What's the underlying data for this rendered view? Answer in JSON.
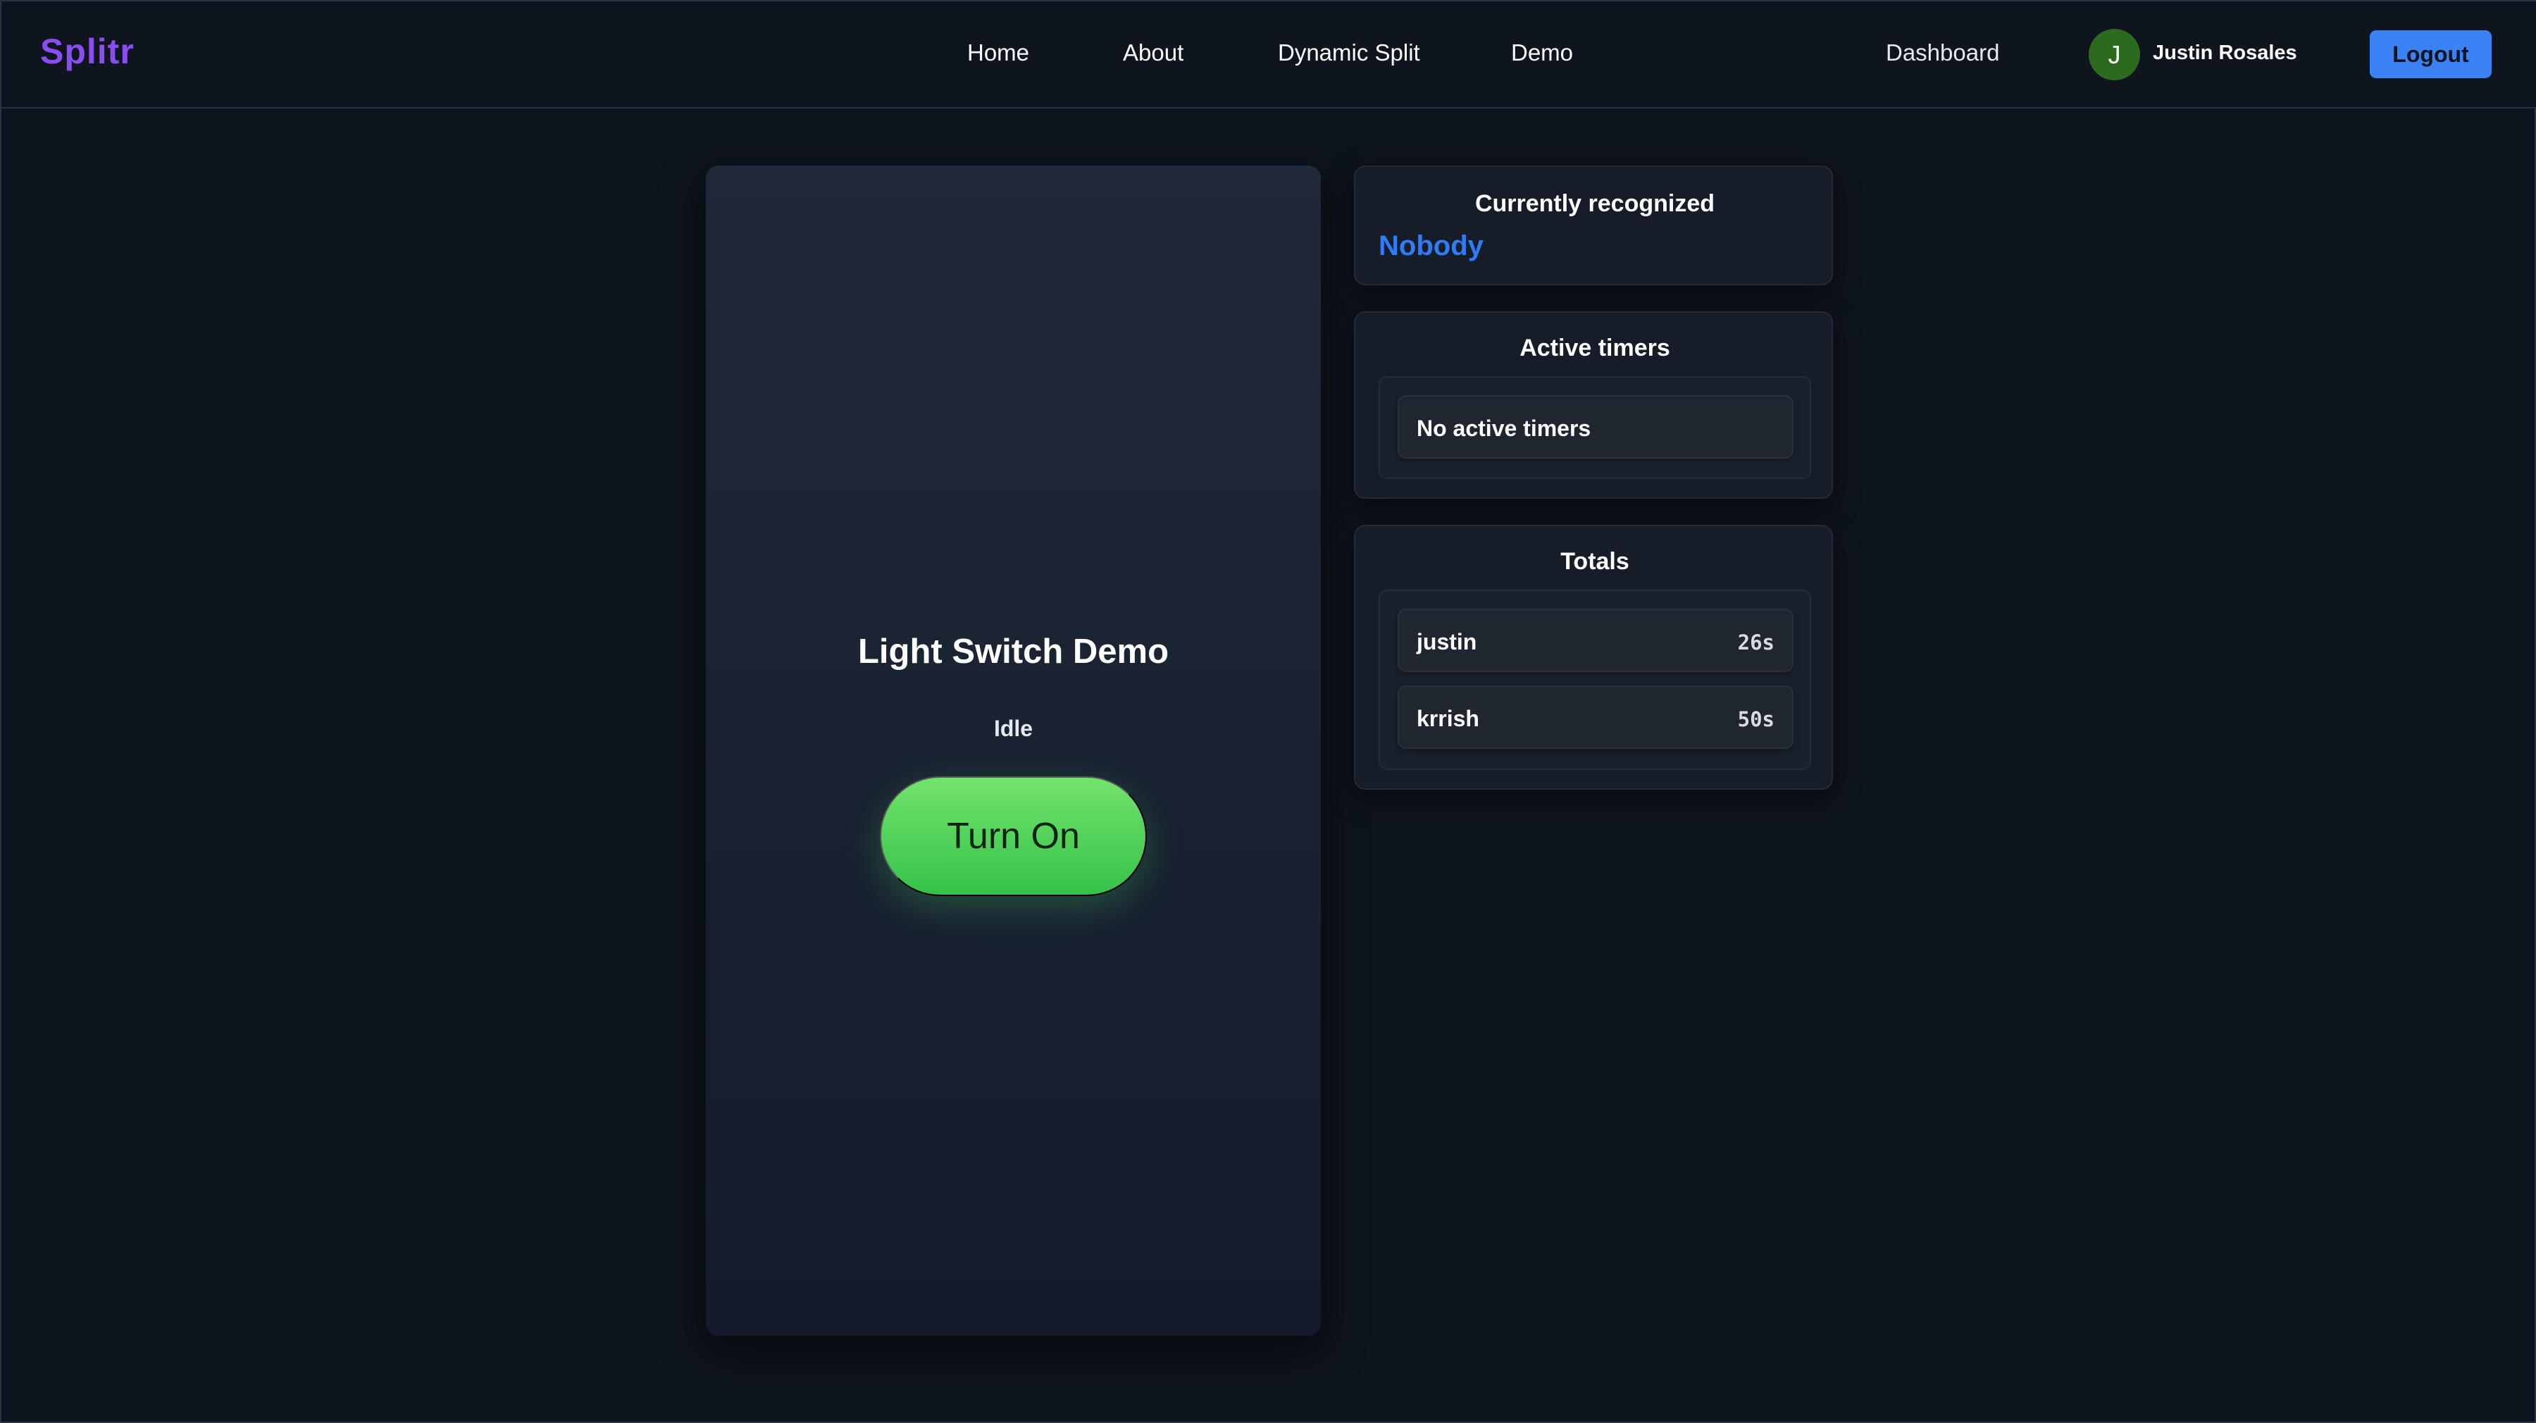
{
  "nav": {
    "logo": "Splitr",
    "links": [
      "Home",
      "About",
      "Dynamic Split",
      "Demo"
    ],
    "dashboard": "Dashboard",
    "user": {
      "initial": "J",
      "name": "Justin Rosales"
    },
    "logout": "Logout"
  },
  "demo": {
    "title": "Light Switch Demo",
    "status": "Idle",
    "button": "Turn On"
  },
  "recognized": {
    "title": "Currently recognized",
    "value": "Nobody"
  },
  "timers": {
    "title": "Active timers",
    "empty": "No active timers"
  },
  "totals": {
    "title": "Totals",
    "rows": [
      {
        "name": "justin",
        "value": "26s"
      },
      {
        "name": "krrish",
        "value": "50s"
      }
    ]
  },
  "colors": {
    "brand": "#8a4df0",
    "accent": "#3b82f6",
    "recognized": "#2f7cf6",
    "button_green": "#4cd35a",
    "avatar": "#2c6b1e"
  }
}
